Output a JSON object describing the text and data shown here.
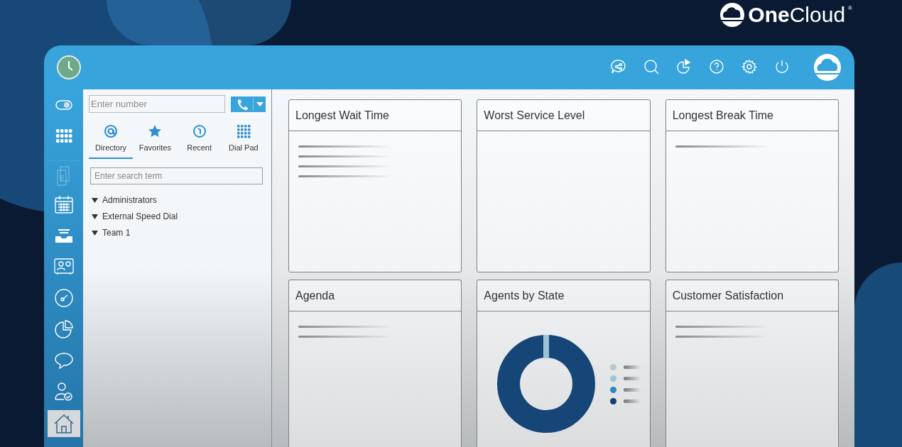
{
  "brand": {
    "bold": "One",
    "light": "Cloud",
    "mark": "®"
  },
  "header_icons": [
    {
      "kind": "share"
    },
    {
      "kind": "search"
    },
    {
      "kind": "pie"
    },
    {
      "kind": "help"
    },
    {
      "kind": "settings"
    },
    {
      "kind": "power"
    }
  ],
  "rail": [
    {
      "kind": "toggle",
      "selected": false,
      "disabled": false
    },
    {
      "kind": "grid",
      "selected": false,
      "disabled": false
    },
    {
      "kind": "documents",
      "selected": false,
      "disabled": true
    },
    {
      "kind": "calendar",
      "selected": false,
      "disabled": false
    },
    {
      "kind": "inbox",
      "selected": false,
      "disabled": false
    },
    {
      "kind": "contact",
      "selected": false,
      "disabled": false
    },
    {
      "kind": "gauge",
      "selected": false,
      "disabled": false
    },
    {
      "kind": "pie",
      "selected": false,
      "disabled": false
    },
    {
      "kind": "chat",
      "selected": false,
      "disabled": false
    },
    {
      "kind": "user-check",
      "selected": false,
      "disabled": false
    },
    {
      "kind": "home",
      "selected": true,
      "disabled": false
    }
  ],
  "dial": {
    "placeholder": "Enter number"
  },
  "tabs": [
    {
      "kind": "at",
      "label": "Directory",
      "selected": true
    },
    {
      "kind": "star",
      "label": "Favorites",
      "selected": false
    },
    {
      "kind": "recent",
      "label": "Recent",
      "selected": false
    },
    {
      "kind": "dialpad",
      "label": "Dial Pad",
      "selected": false
    }
  ],
  "search": {
    "placeholder": "Enter search term"
  },
  "tree": [
    {
      "label": "Administrators",
      "expanded": true
    },
    {
      "label": "External Speed Dial",
      "expanded": true
    },
    {
      "label": "Team 1",
      "expanded": true
    }
  ],
  "cards": [
    {
      "title": "Longest Wait Time",
      "kind": "lines"
    },
    {
      "title": "Worst Service Level",
      "kind": "empty"
    },
    {
      "title": "Longest Break Time",
      "kind": "lines"
    },
    {
      "title": "Agenda",
      "kind": "lines"
    },
    {
      "title": "Agents by State",
      "kind": "donut",
      "legend": [
        {
          "color": "#b8c8cc"
        },
        {
          "color": "#9cc4d8"
        },
        {
          "color": "#2e88c0"
        },
        {
          "color": "#123f6e"
        }
      ]
    },
    {
      "title": "Customer Satisfaction",
      "kind": "lines"
    }
  ]
}
